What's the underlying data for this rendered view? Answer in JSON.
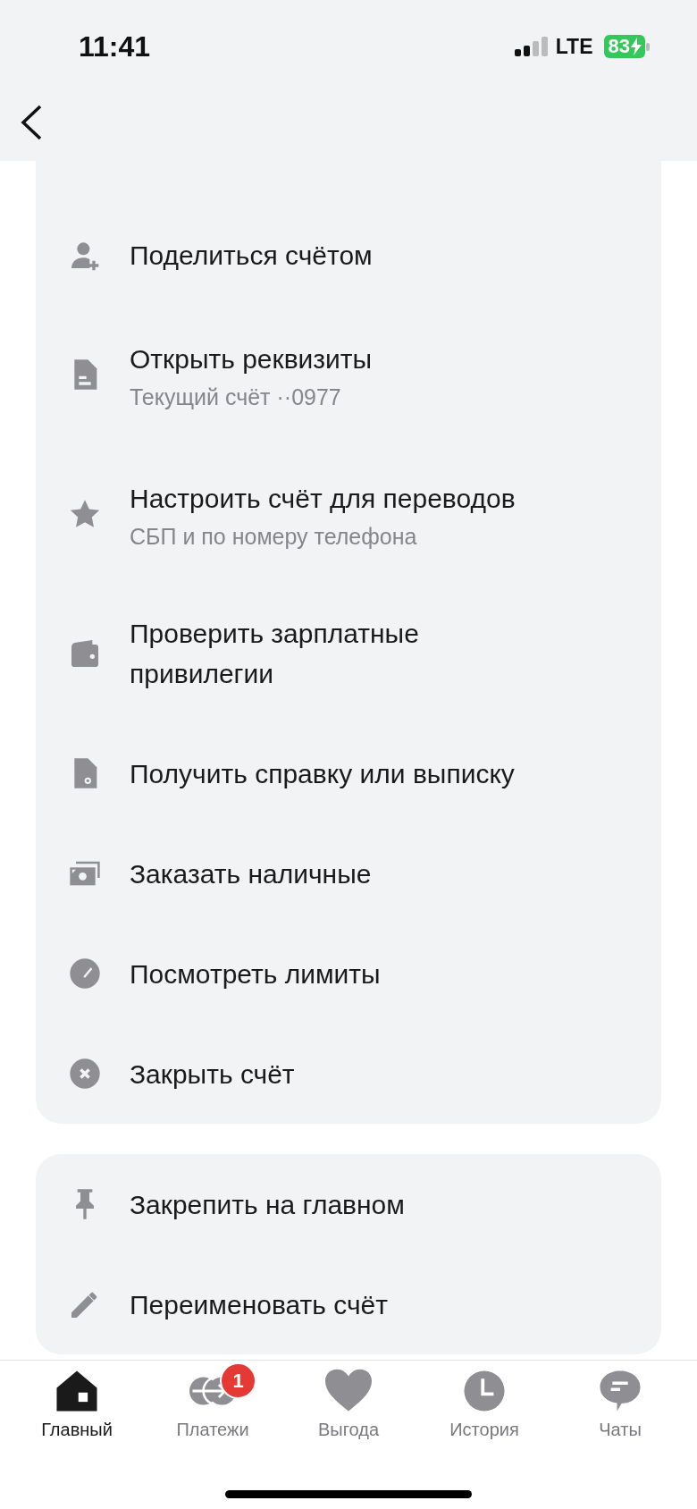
{
  "status_bar": {
    "time": "11:41",
    "network": "LTE",
    "battery": "83"
  },
  "menu_groups": [
    {
      "items": [
        {
          "title": "Поделиться счётом"
        },
        {
          "title": "Открыть реквизиты",
          "subtitle": "Текущий счёт ··0977"
        },
        {
          "title": "Настроить счёт для переводов",
          "subtitle": "СБП и по номеру телефона"
        },
        {
          "title": "Проверить зарплатные привилегии"
        },
        {
          "title": "Получить справку или выписку"
        },
        {
          "title": "Заказать наличные"
        },
        {
          "title": "Посмотреть лимиты"
        },
        {
          "title": "Закрыть счёт"
        }
      ]
    },
    {
      "items": [
        {
          "title": "Закрепить на главном"
        },
        {
          "title": "Переименовать счёт"
        }
      ]
    }
  ],
  "tabs": [
    {
      "label": "Главный",
      "selected": true
    },
    {
      "label": "Платежи",
      "selected": false,
      "badge": "1"
    },
    {
      "label": "Выгода",
      "selected": false
    },
    {
      "label": "История",
      "selected": false
    },
    {
      "label": "Чаты",
      "selected": false
    }
  ]
}
